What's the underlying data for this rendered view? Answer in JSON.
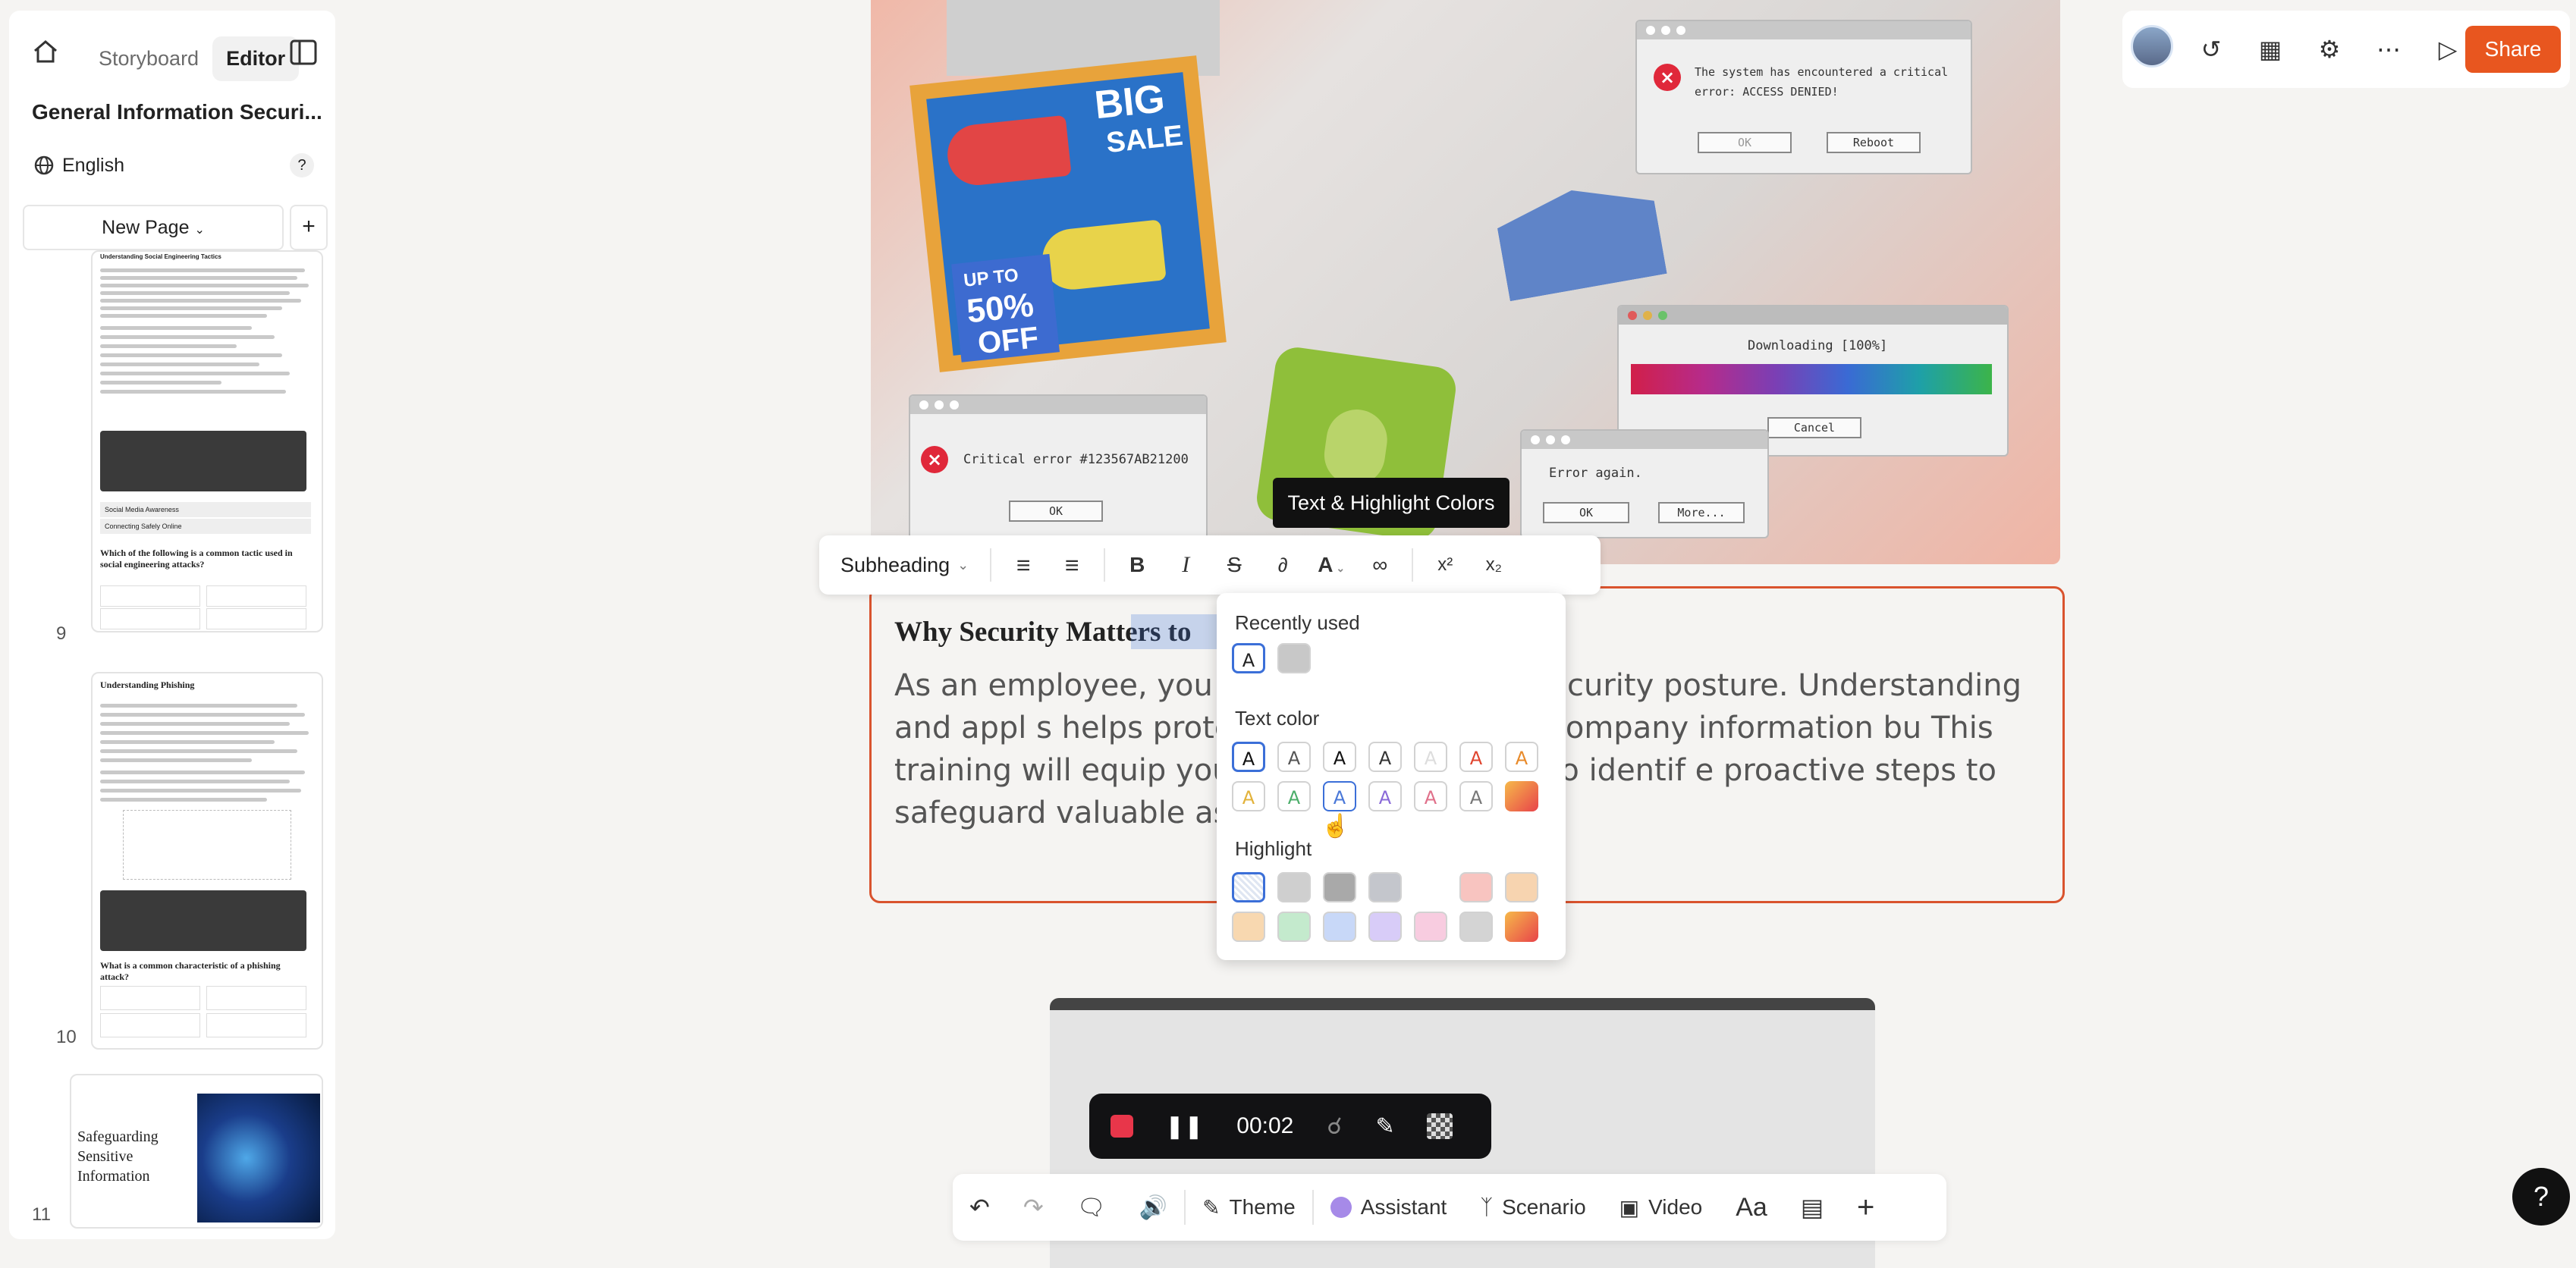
{
  "sidebar": {
    "tabs": [
      "Storyboard",
      "Editor"
    ],
    "active_tab": "Editor",
    "course_title": "General Information Securi...",
    "language": "English",
    "help": "?",
    "new_page": "New Page",
    "add": "+",
    "pages": [
      {
        "number": "9",
        "question": "Which of the following is a common tactic used in social engineering attacks?",
        "title": "Understanding Social Engineering Tactics",
        "rows": [
          "Social Media Awareness",
          "Connecting Safely Online"
        ]
      },
      {
        "number": "10",
        "question": "What is a common characteristic of a phishing attack?",
        "title": "Understanding Phishing"
      },
      {
        "number": "11",
        "title": "Safeguarding Sensitive Information"
      }
    ]
  },
  "hero": {
    "sale_big": "BIG",
    "sale_word": "SALE",
    "promo_lines": [
      "UP TO",
      "50%",
      "OFF"
    ],
    "critical_msg": "The system has encountered a critical error: ACCESS DENIED!",
    "ok": "OK",
    "reboot": "Reboot",
    "error_code": "Critical error #123567AB21200",
    "download_text": "Downloading [100%]",
    "cancel": "Cancel",
    "error_again": "Error again.",
    "more": "More..."
  },
  "tooltip": "Text & Highlight Colors",
  "format_toolbar": {
    "style": "Subheading",
    "icons": [
      "bullet-list",
      "numbered-list",
      "bold",
      "italic",
      "strikethrough",
      "formula",
      "text-color",
      "link",
      "superscript",
      "subscript"
    ]
  },
  "card": {
    "heading": "Why Security Matters to",
    "body": "As an employee, you are                                       your company's security posture. Understanding and appl                                     s helps protect not only sensitive company information bu                                      This training will equip you with the knowledge to identif                                    e proactive steps to safeguard valuable assets, both at w"
  },
  "color_popover": {
    "recently_used": "Recently used",
    "text_color": "Text color",
    "highlight": "Highlight",
    "glyph": "A",
    "recent_colors": [
      "#222222",
      "#c8c8c8"
    ],
    "text_colors_row1": [
      "#111111",
      "#555555",
      "#111111",
      "#333333",
      "#dddddd",
      "#e0452f",
      "#e88a2a"
    ],
    "text_colors_row2": [
      "#e2b23a",
      "#4cae6a",
      "#4a78d8",
      "#8a6ad8",
      "#e0708a",
      "#777777",
      "gradient"
    ],
    "highlight_row1": [
      "checker",
      "#cfcfcf",
      "#a9a9a9",
      "#c4c6cc",
      "#ffffff",
      "#f8c4c0",
      "#f7d4b0"
    ],
    "highlight_row2": [
      "#f8d8b0",
      "#c4eacd",
      "#c8d8f8",
      "#d8ccf8",
      "#f8cce0",
      "#d4d4d4",
      "gradient"
    ]
  },
  "top_right": {
    "share": "Share",
    "icons": [
      "avatar",
      "history-icon",
      "analytics-icon",
      "settings-icon",
      "more-icon",
      "play-icon"
    ]
  },
  "recording": {
    "time": "00:02"
  },
  "bottom_bar": {
    "theme": "Theme",
    "assistant": "Assistant",
    "scenario": "Scenario",
    "video": "Video",
    "typography": "Aa",
    "plus": "+"
  },
  "help_button": "?",
  "colors": {
    "accent": "#e8561f",
    "card_border": "#d9532e",
    "selection": "#3b6fd8"
  }
}
